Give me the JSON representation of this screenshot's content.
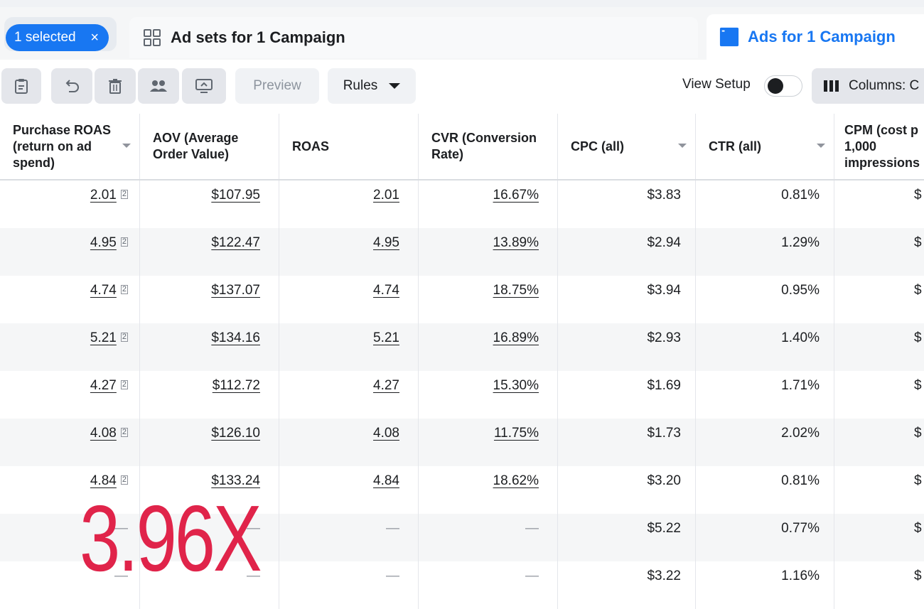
{
  "selection_chip": {
    "label": "1 selected",
    "close": "×"
  },
  "tabs": [
    {
      "label": "Ad sets for 1 Campaign",
      "icon": "grid-icon",
      "active": false
    },
    {
      "label": "Ads for 1 Campaign",
      "icon": "ad-icon",
      "active": true
    }
  ],
  "toolbar": {
    "preview_label": "Preview",
    "rules_label": "Rules",
    "view_setup_label": "View Setup",
    "columns_label": "Columns: C"
  },
  "columns": [
    "Purchase ROAS (return on ad spend)",
    "AOV (Average Order Value)",
    "ROAS",
    "CVR (Conversion Rate)",
    "CPC (all)",
    "CTR (all)",
    "CPM (cost p 1,000 impressions"
  ],
  "rows": [
    {
      "proas": "2.01",
      "aov": "$107.95",
      "roas": "2.01",
      "cvr": "16.67%",
      "cpc": "$3.83",
      "ctr": "0.81%",
      "cpm": "$"
    },
    {
      "proas": "4.95",
      "aov": "$122.47",
      "roas": "4.95",
      "cvr": "13.89%",
      "cpc": "$2.94",
      "ctr": "1.29%",
      "cpm": "$"
    },
    {
      "proas": "4.74",
      "aov": "$137.07",
      "roas": "4.74",
      "cvr": "18.75%",
      "cpc": "$3.94",
      "ctr": "0.95%",
      "cpm": "$"
    },
    {
      "proas": "5.21",
      "aov": "$134.16",
      "roas": "5.21",
      "cvr": "16.89%",
      "cpc": "$2.93",
      "ctr": "1.40%",
      "cpm": "$"
    },
    {
      "proas": "4.27",
      "aov": "$112.72",
      "roas": "4.27",
      "cvr": "15.30%",
      "cpc": "$1.69",
      "ctr": "1.71%",
      "cpm": "$"
    },
    {
      "proas": "4.08",
      "aov": "$126.10",
      "roas": "4.08",
      "cvr": "11.75%",
      "cpc": "$1.73",
      "ctr": "2.02%",
      "cpm": "$"
    },
    {
      "proas": "4.84",
      "aov": "$133.24",
      "roas": "4.84",
      "cvr": "18.62%",
      "cpc": "$3.20",
      "ctr": "0.81%",
      "cpm": "$"
    },
    {
      "proas": "—",
      "aov": "—",
      "roas": "—",
      "cvr": "—",
      "cpc": "$5.22",
      "ctr": "0.77%",
      "cpm": "$"
    },
    {
      "proas": "—",
      "aov": "—",
      "roas": "—",
      "cvr": "—",
      "cpc": "$3.22",
      "ctr": "1.16%",
      "cpm": "$"
    }
  ],
  "overlay_text": "3.96X",
  "colors": {
    "accent": "#1877f2",
    "overlay": "#e0244a"
  }
}
